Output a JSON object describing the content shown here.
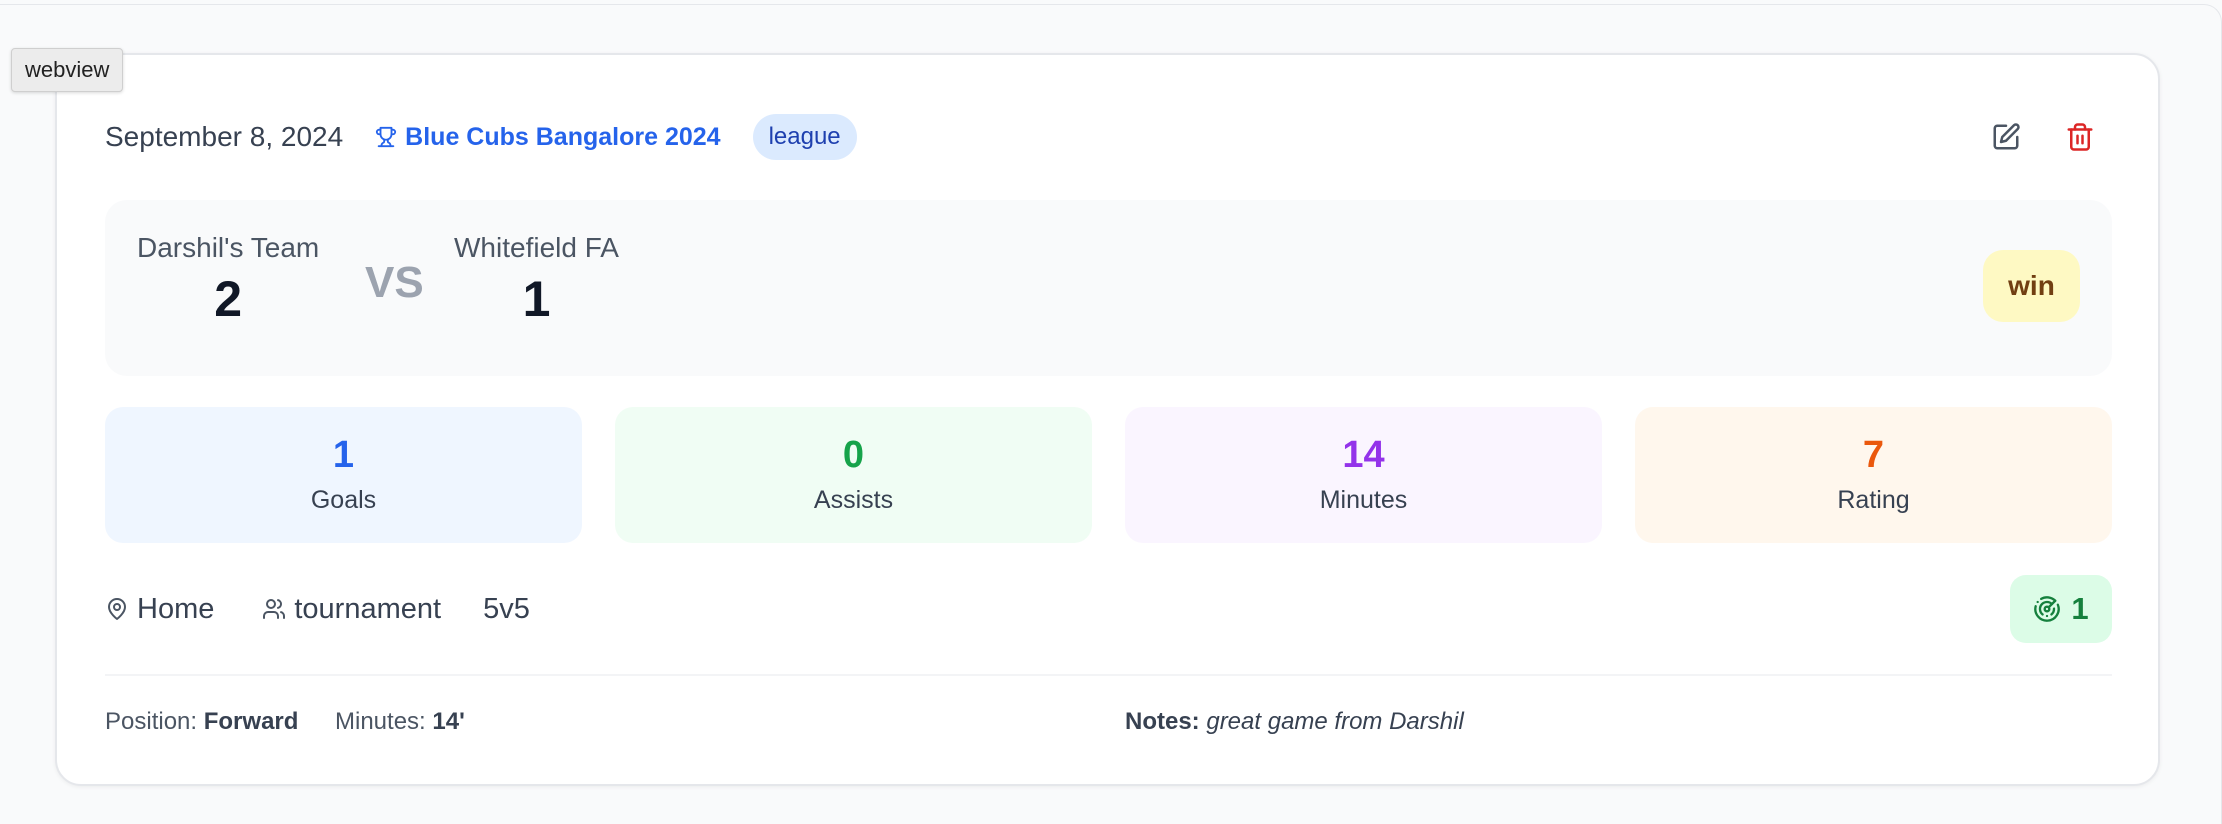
{
  "tooltip": "webview",
  "match": {
    "date": "September 8, 2024",
    "tournament": "Blue Cubs Bangalore 2024",
    "type": "league",
    "home_team": "Darshil's Team",
    "home_score": "2",
    "vs": "VS",
    "away_team": "Whitefield FA",
    "away_score": "1",
    "result": "win"
  },
  "stats": [
    {
      "value": "1",
      "label": "Goals",
      "color": "#2563eb"
    },
    {
      "value": "0",
      "label": "Assists",
      "color": "#16a34a"
    },
    {
      "value": "14",
      "label": "Minutes",
      "color": "#9333ea"
    },
    {
      "value": "7",
      "label": "Rating",
      "color": "#ea580c"
    }
  ],
  "meta": {
    "venue": "Home",
    "competition": "tournament",
    "format": "5v5",
    "shots": "1"
  },
  "details": {
    "position_label": "Position:",
    "position_value": "Forward",
    "minutes_label": "Minutes:",
    "minutes_value": "14'",
    "notes_label": "Notes:",
    "notes_value": "great game from Darshil"
  },
  "icons": {
    "tournament": "trophy-icon",
    "edit": "edit-icon",
    "delete": "trash-icon",
    "venue": "map-pin-icon",
    "competition": "users-icon",
    "shots": "target-icon"
  }
}
